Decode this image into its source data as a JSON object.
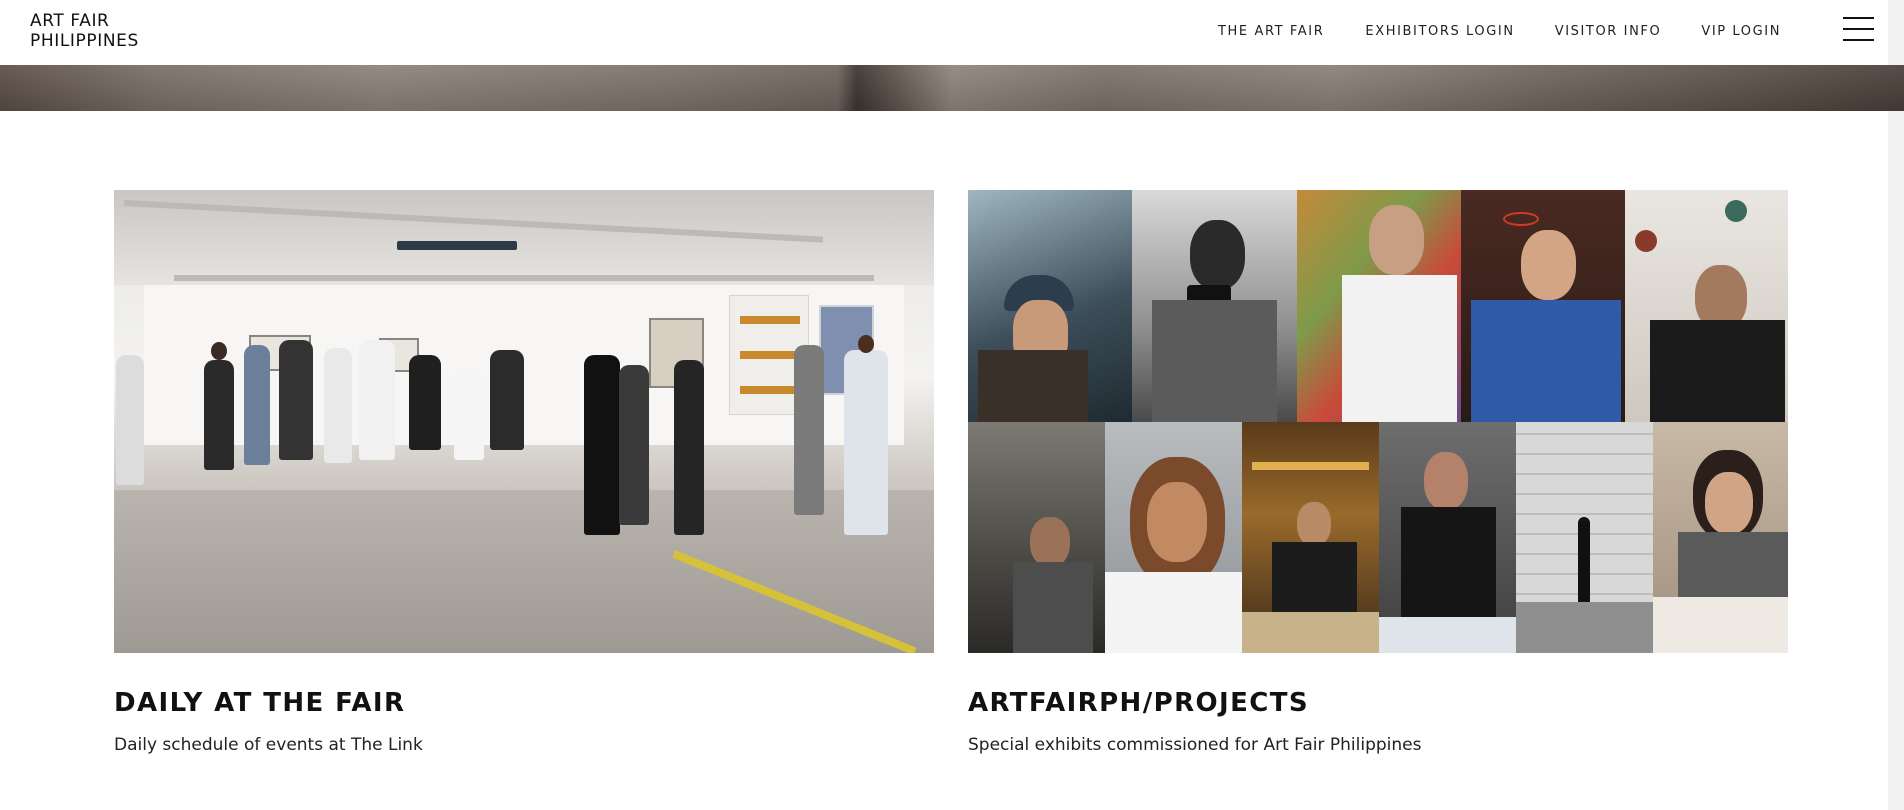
{
  "site": {
    "logo_line1": "ART FAIR",
    "logo_line2": "PHILIPPINES"
  },
  "nav": {
    "items": [
      {
        "label": "THE ART FAIR"
      },
      {
        "label": "EXHIBITORS LOGIN"
      },
      {
        "label": "VISITOR INFO"
      },
      {
        "label": "VIP LOGIN"
      }
    ],
    "menu_icon": "hamburger-menu-icon"
  },
  "cards": [
    {
      "title": "DAILY AT THE FAIR",
      "subtitle": "Daily schedule of events at The Link",
      "image": "art-fair-gallery-crowd-photo"
    },
    {
      "title": "ARTFAIRPH/PROJECTS",
      "subtitle": "Special exhibits commissioned for Art Fair Philippines",
      "image": "artist-portraits-collage-photo"
    }
  ]
}
